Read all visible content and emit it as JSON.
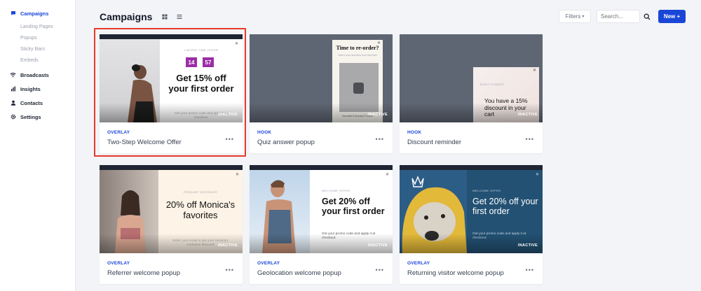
{
  "sidebar": {
    "items": [
      {
        "label": "Campaigns",
        "icon": "chat-icon"
      },
      {
        "label": "Landing Pages"
      },
      {
        "label": "Popups"
      },
      {
        "label": "Sticky Bars"
      },
      {
        "label": "Embeds"
      },
      {
        "label": "Broadcasts",
        "icon": "wifi-icon"
      },
      {
        "label": "Insights",
        "icon": "bar-chart-icon"
      },
      {
        "label": "Contacts",
        "icon": "person-icon"
      },
      {
        "label": "Settings",
        "icon": "gear-icon"
      }
    ]
  },
  "header": {
    "title": "Campaigns",
    "filters_label": "Filters",
    "search_placeholder": "Search...",
    "new_label": "New +"
  },
  "colors": {
    "accent": "#1a46d8",
    "highlight": "#e53a2a",
    "timer": "#9b2ea5"
  },
  "cards": [
    {
      "type": "OVERLAY",
      "name": "Two-Step Welcome Offer",
      "status": "INACTIVE",
      "more": "•••",
      "popup": {
        "eyebrow": "LIMITED TIME OFFER",
        "timer_a": "14",
        "timer_b": "57",
        "headline": "Get 15% off your first order",
        "body": "Get your promo code and apply it at checkout."
      }
    },
    {
      "type": "HOOK",
      "name": "Quiz answer popup",
      "status": "INACTIVE",
      "more": "•••",
      "popup": {
        "headline": "Time to re-order?",
        "sub": "Here's your favorites from last time",
        "footer": "Beautiful Everyday Product"
      }
    },
    {
      "type": "HOOK",
      "name": "Discount reminder",
      "status": "INACTIVE",
      "more": "•••",
      "popup": {
        "eyebrow": "DON'T FORGET",
        "headline": "You have a 15% discount in your cart"
      }
    },
    {
      "type": "OVERLAY",
      "name": "Referrer welcome popup",
      "status": "INACTIVE",
      "more": "•••",
      "popup": {
        "eyebrow": "PODCAST DISCOUNT",
        "headline": "20% off Monica's favorites",
        "body": "Enter your email to get your Monica's exclusive discount"
      }
    },
    {
      "type": "OVERLAY",
      "name": "Geolocation welcome popup",
      "status": "INACTIVE",
      "more": "•••",
      "popup": {
        "eyebrow": "WELCOME OFFER",
        "headline": "Get 20% off your first order",
        "body": "Get your promo code and apply it at checkout."
      }
    },
    {
      "type": "OVERLAY",
      "name": "Returning visitor welcome popup",
      "status": "INACTIVE",
      "more": "•••",
      "popup": {
        "eyebrow": "WELCOME OFFER",
        "headline": "Get 20% off your first order",
        "body": "Get your promo code and apply it at checkout."
      }
    }
  ]
}
